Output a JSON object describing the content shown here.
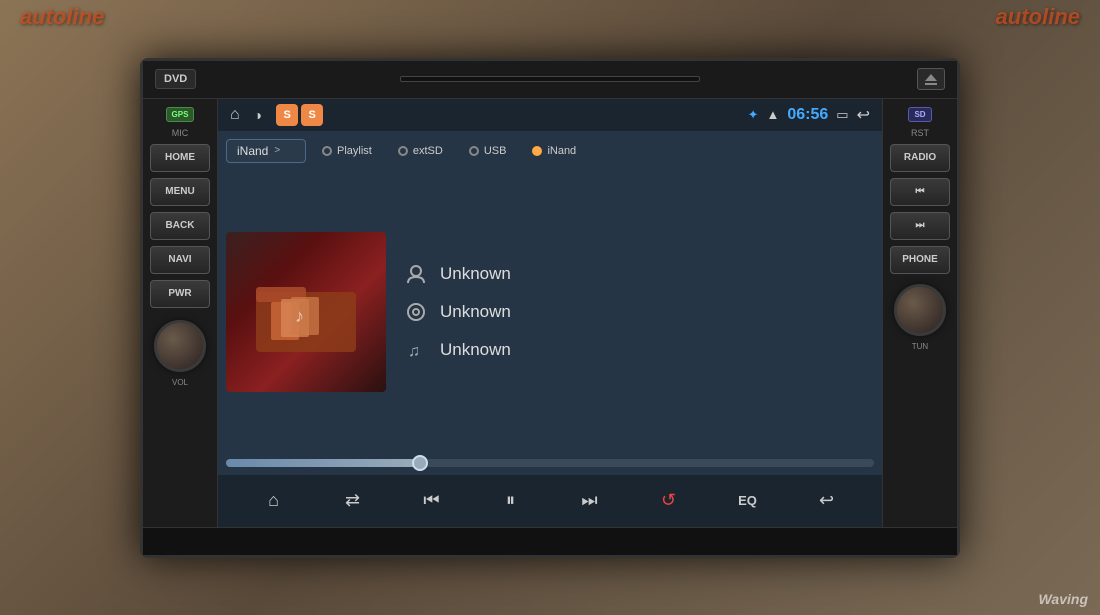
{
  "brand": {
    "top_left": "autoline",
    "top_right": "autoline",
    "watermark": "Waving"
  },
  "unit": {
    "dvd_label": "DVD",
    "gps_label": "GPS",
    "mic_label": "MIC",
    "sd_label": "SD",
    "rst_label": "RST",
    "vol_label": "VOL",
    "tun_label": "TUN",
    "buttons": [
      {
        "label": "HOME"
      },
      {
        "label": "MENU"
      },
      {
        "label": "BACK"
      },
      {
        "label": "NAVI"
      },
      {
        "label": "PWR"
      }
    ],
    "right_buttons": [
      {
        "label": "RADIO"
      },
      {
        "label": "PHONE"
      }
    ]
  },
  "status_bar": {
    "time": "06:56",
    "ss_badge1": "S",
    "ss_badge2": "S"
  },
  "player": {
    "source_label": "iNand",
    "source_arrow": ">",
    "tabs": [
      {
        "label": "Playlist",
        "active": false
      },
      {
        "label": "extSD",
        "active": false
      },
      {
        "label": "USB",
        "active": false
      },
      {
        "label": "iNand",
        "active": true
      }
    ],
    "track_artist": "Unknown",
    "track_album": "Unknown",
    "track_title": "Unknown",
    "progress_percent": 30,
    "eq_label": "EQ"
  },
  "controls": {
    "home": "⌂",
    "shuffle": "⇄",
    "prev": "⏮",
    "play_pause": "⏯",
    "next": "⏭",
    "repeat": "↺",
    "eq": "EQ",
    "back": "↩"
  }
}
